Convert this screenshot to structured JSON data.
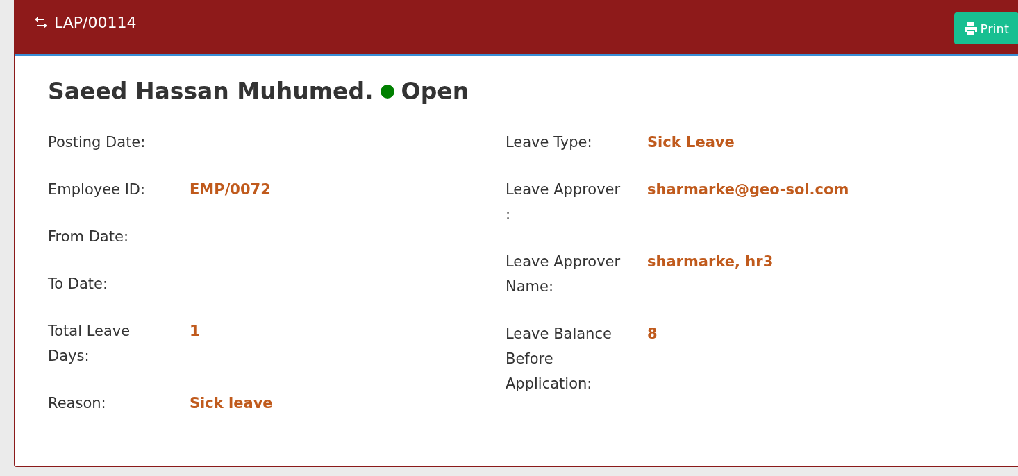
{
  "header": {
    "title": "LAP/00114",
    "print_button": "Print"
  },
  "employee_name": "Saeed Hassan Muhumed.",
  "status": {
    "label": "Open",
    "color": "#008000"
  },
  "left_fields": [
    {
      "label": "Posting Date:"
    },
    {
      "label": "Employee ID:",
      "value": "EMP/0072"
    },
    {
      "label": "From Date:"
    },
    {
      "label": "To Date:"
    },
    {
      "label": "Total Leave Days:",
      "value": "1"
    },
    {
      "label": "Reason:",
      "value": "Sick leave"
    }
  ],
  "right_fields": [
    {
      "label": "Leave Type:",
      "value": "Sick Leave"
    },
    {
      "label": "Leave Approver :",
      "value": "sharmarke@geo-sol.com"
    },
    {
      "label": "Leave Approver Name:",
      "value": "sharmarke, hr3"
    },
    {
      "label": "Leave Balance Before Application:",
      "value": "8"
    }
  ]
}
